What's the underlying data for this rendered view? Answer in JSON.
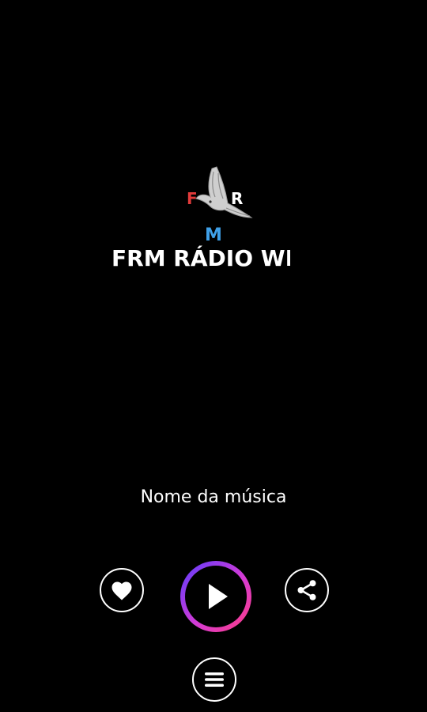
{
  "logo": {
    "letter_f": "F",
    "letter_r": "R",
    "letter_m": "M",
    "colors": {
      "f": "#e23b3b",
      "r": "#ffffff",
      "m": "#3fa0e8"
    }
  },
  "station": {
    "title": "FRM RÁDIO WE"
  },
  "player": {
    "song_name": "Nome da música",
    "ring_gradient": [
      "#5b3cff",
      "#d43bd6",
      "#ff3d7f"
    ]
  },
  "controls": {
    "like_icon": "heart-icon",
    "play_icon": "play-icon",
    "share_icon": "share-icon",
    "menu_icon": "menu-icon"
  }
}
